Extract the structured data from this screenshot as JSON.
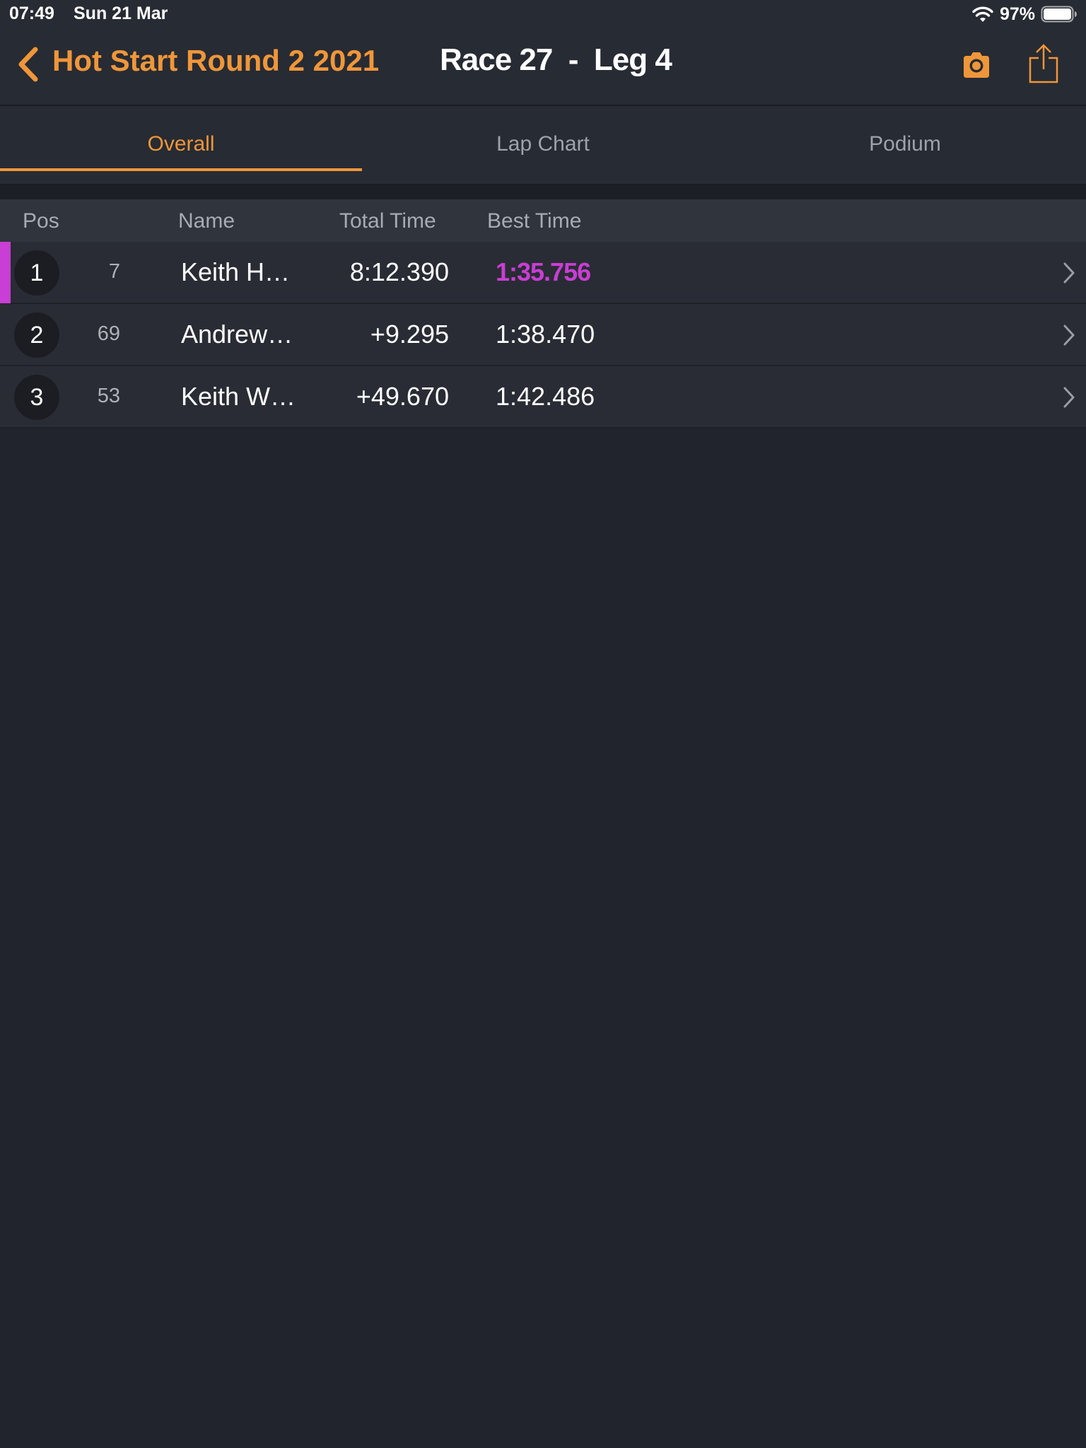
{
  "status_bar": {
    "time": "07:49",
    "date": "Sun 21 Mar",
    "battery": "97%"
  },
  "nav": {
    "back_label": "Hot Start Round 2 2021",
    "title": "Race 27  -  Leg 4",
    "accent_color": "#f0963a"
  },
  "tabs": [
    {
      "label": "Overall",
      "active": true
    },
    {
      "label": "Lap Chart",
      "active": false
    },
    {
      "label": "Podium",
      "active": false
    }
  ],
  "table": {
    "headers": {
      "pos": "Pos",
      "name": "Name",
      "total_time": "Total Time",
      "best_time": "Best Time"
    },
    "fastest_lap_color": "#c93ed4",
    "rows": [
      {
        "pos": "1",
        "car": "7",
        "name": "Keith H…",
        "total_time": "8:12.390",
        "best_time": "1:35.756",
        "fastest": true
      },
      {
        "pos": "2",
        "car": "69",
        "name": "Andrew…",
        "total_time": "+9.295",
        "best_time": "1:38.470",
        "fastest": false
      },
      {
        "pos": "3",
        "car": "53",
        "name": "Keith W…",
        "total_time": "+49.670",
        "best_time": "1:42.486",
        "fastest": false
      }
    ]
  },
  "icons": {
    "back": "chevron-left-icon",
    "camera": "camera-icon",
    "share": "share-icon",
    "row_disclosure": "chevron-right-icon",
    "wifi": "wifi-icon",
    "battery": "battery-icon"
  }
}
